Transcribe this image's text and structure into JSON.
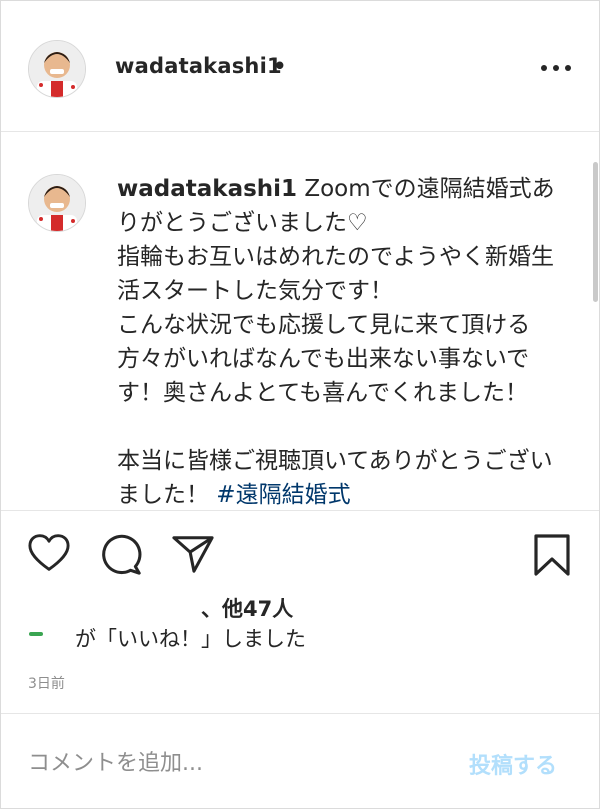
{
  "header": {
    "username": "wadatakashi1",
    "separator": "•"
  },
  "caption": {
    "username": "wadatakashi1",
    "text": " Zoomでの遠隔結婚式ありがとうございました♡\n指輪もお互いはめれたのでようやく新婚生活スタートした気分です！\nこんな状況でも応援して見に来て頂ける方々がいればなんでも出来ない事ないです！奥さんよとても喜んでくれました！\n\n本当に皆様ご視聴頂いてありがとうございました！",
    "hashtags": " #遠隔結婚式"
  },
  "engagement": {
    "likes_text": "、他47人",
    "liked_line": "が「いいね！」しました",
    "time_ago": "3日前"
  },
  "comment": {
    "placeholder": "コメントを追加...",
    "post_label": "投稿する"
  },
  "colors": {
    "border": "#dbdbdb",
    "text": "#262626",
    "secondary": "#8e8e8e",
    "post_disabled": "#b2dffc",
    "hashtag": "#00376b"
  },
  "icons": [
    "avatar",
    "more-options-icon",
    "heart-icon",
    "comment-icon",
    "share-icon",
    "bookmark-icon"
  ]
}
